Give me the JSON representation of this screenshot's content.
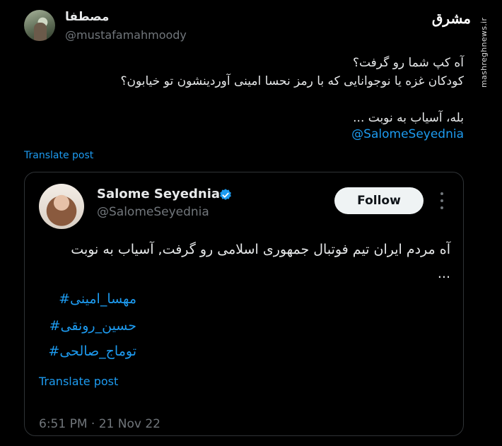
{
  "author": {
    "name": "مصطفا",
    "handle": "@mustafamahmoody"
  },
  "watermark": {
    "logo_text": "مشرق",
    "url": "mashreghnews.ir"
  },
  "tweet": {
    "lines": [
      "آه کپ شما رو گرفت؟",
      "کودکان غزه یا نوجوانایی که با رمز نحسا امینی آوردینشون تو خیابون؟",
      "",
      "بله، آسیاب به نوبت ..."
    ],
    "mention": "@SalomeSeyednia",
    "translate_label": "Translate post"
  },
  "quoted": {
    "name": "Salome Seyednia",
    "handle": "@SalomeSeyednia",
    "follow_label": "Follow",
    "text": "آه مردم ایران تیم فوتبال جمهوری اسلامی رو گرفت, آسیاب به نوبت ...",
    "hashtags": [
      "مهسا_امینی#",
      "حسین_رونقی#",
      "توماج_صالحی#"
    ],
    "translate_label": "Translate post",
    "timestamp": "6:51 PM · 21 Nov 22"
  },
  "colors": {
    "background": "#000000",
    "text": "#e7e9ea",
    "secondary": "#71767b",
    "accent": "#1d9bf0",
    "border": "#2f3336",
    "verified": "#1d9bf0"
  },
  "icons": [
    "verified-badge-icon",
    "more-options-icon"
  ]
}
